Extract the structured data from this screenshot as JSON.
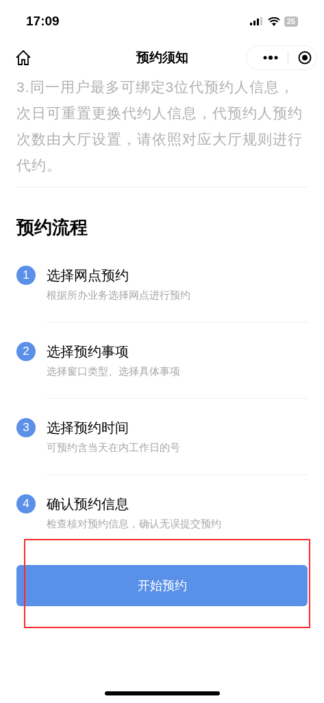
{
  "status_bar": {
    "time": "17:09",
    "battery": "25"
  },
  "nav": {
    "title": "预约须知"
  },
  "notice": "3.同一用户最多可绑定3位代预约人信息，次日可重置更换代约人信息，代预约人预约次数由大厅设置，请依照对应大厅规则进行代约。",
  "section_title": "预约流程",
  "steps": [
    {
      "number": "1",
      "title": "选择网点预约",
      "description": "根据所办业务选择网点进行预约"
    },
    {
      "number": "2",
      "title": "选择预约事项",
      "description": "选择窗口类型、选择具体事项"
    },
    {
      "number": "3",
      "title": "选择预约时间",
      "description": "可预约含当天在内工作日的号"
    },
    {
      "number": "4",
      "title": "确认预约信息",
      "description": "检查核对预约信息，确认无误提交预约"
    }
  ],
  "start_button": "开始预约",
  "highlight_box": true
}
